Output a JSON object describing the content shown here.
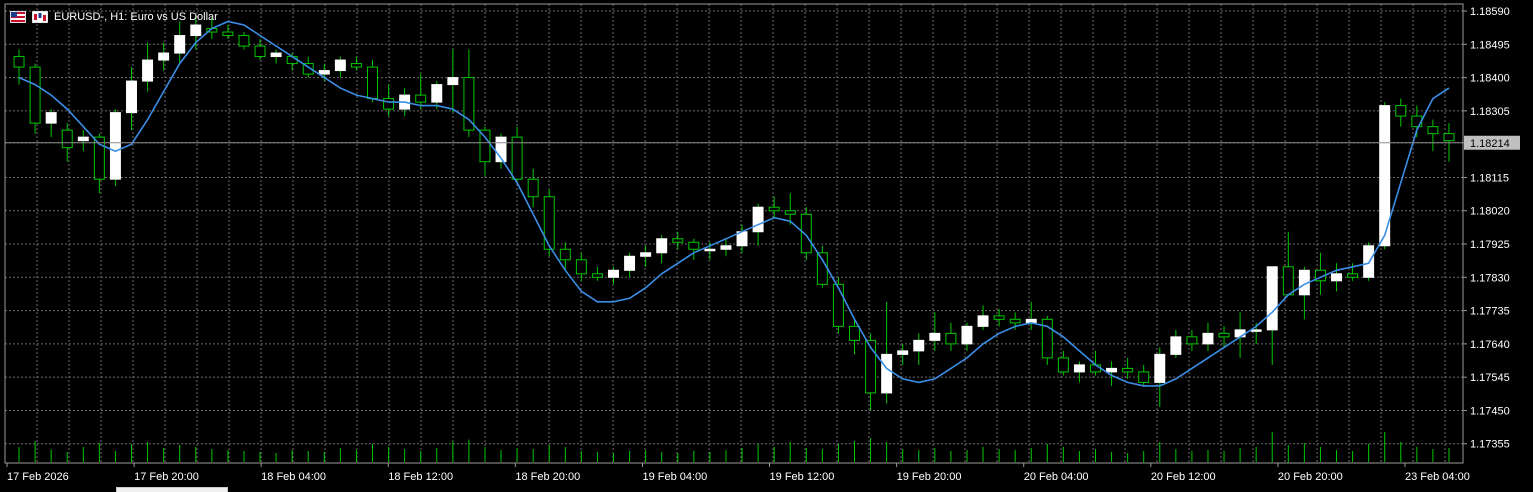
{
  "window": {
    "symbol_title": "EURUSD-, H1:  Euro vs US Dollar",
    "current_price_label": "1.18214"
  },
  "colors": {
    "background": "#000000",
    "grid": "#6b6b6b",
    "bull_candle": "#ffffff",
    "wick": "#00c800",
    "volume": "#00c800",
    "moving_average": "#3a8ee6",
    "bid_line": "#8c8c8c",
    "current_price_bg": "#c0c0c0"
  },
  "icons": [
    "flag-icon",
    "chart-type-icon"
  ],
  "chart_data": {
    "type": "candlestick",
    "timeframe": "H1",
    "price_axis": {
      "ticks": [
        "1.18590",
        "1.18495",
        "1.18400",
        "1.18305",
        "1.18214",
        "1.18115",
        "1.18020",
        "1.17925",
        "1.17830",
        "1.17735",
        "1.17640",
        "1.17545",
        "1.17450",
        "1.17355"
      ],
      "ylim": [
        1.173,
        1.1861
      ],
      "grid": true
    },
    "time_axis": {
      "labels": [
        "17 Feb 2026",
        "17 Feb 20:00",
        "18 Feb 04:00",
        "18 Feb 12:00",
        "18 Feb 20:00",
        "19 Feb 04:00",
        "19 Feb 12:00",
        "19 Feb 20:00",
        "20 Feb 04:00",
        "20 Feb 12:00",
        "20 Feb 20:00",
        "23 Feb 04:00"
      ]
    },
    "current_price": 1.18214,
    "candles": [
      [
        1.1846,
        1.1848,
        1.1838,
        1.1843
      ],
      [
        1.1843,
        1.1844,
        1.1824,
        1.1827
      ],
      [
        1.1827,
        1.1831,
        1.1823,
        1.183
      ],
      [
        1.1825,
        1.1827,
        1.1816,
        1.182
      ],
      [
        1.1822,
        1.1825,
        1.1819,
        1.1823
      ],
      [
        1.1823,
        1.1824,
        1.1807,
        1.1811
      ],
      [
        1.1811,
        1.1831,
        1.1809,
        1.183
      ],
      [
        1.183,
        1.1843,
        1.1825,
        1.1839
      ],
      [
        1.1839,
        1.185,
        1.1836,
        1.1845
      ],
      [
        1.1845,
        1.185,
        1.1842,
        1.1847
      ],
      [
        1.1847,
        1.1856,
        1.1844,
        1.1852
      ],
      [
        1.1852,
        1.1858,
        1.1848,
        1.1855
      ],
      [
        1.1854,
        1.1857,
        1.1851,
        1.1853
      ],
      [
        1.1853,
        1.1855,
        1.1851,
        1.1852
      ],
      [
        1.1852,
        1.1853,
        1.1848,
        1.1849
      ],
      [
        1.1849,
        1.1851,
        1.1845,
        1.1846
      ],
      [
        1.1846,
        1.1848,
        1.1844,
        1.1847
      ],
      [
        1.1846,
        1.1847,
        1.1842,
        1.1844
      ],
      [
        1.1844,
        1.1846,
        1.184,
        1.1841
      ],
      [
        1.1841,
        1.1844,
        1.1839,
        1.1842
      ],
      [
        1.1842,
        1.1846,
        1.184,
        1.1845
      ],
      [
        1.1844,
        1.1846,
        1.1842,
        1.1843
      ],
      [
        1.1843,
        1.1845,
        1.1833,
        1.1834
      ],
      [
        1.1834,
        1.1838,
        1.1829,
        1.1831
      ],
      [
        1.1831,
        1.1837,
        1.1829,
        1.1835
      ],
      [
        1.1835,
        1.1841,
        1.1831,
        1.1833
      ],
      [
        1.1833,
        1.1839,
        1.1831,
        1.1838
      ],
      [
        1.1838,
        1.1848,
        1.183,
        1.184
      ],
      [
        1.184,
        1.1848,
        1.1823,
        1.1825
      ],
      [
        1.1825,
        1.1826,
        1.1812,
        1.1816
      ],
      [
        1.1816,
        1.1824,
        1.1814,
        1.1823
      ],
      [
        1.1823,
        1.1826,
        1.181,
        1.1811
      ],
      [
        1.1811,
        1.1814,
        1.1803,
        1.1806
      ],
      [
        1.1806,
        1.1808,
        1.1789,
        1.1791
      ],
      [
        1.1791,
        1.1793,
        1.1785,
        1.1788
      ],
      [
        1.1788,
        1.179,
        1.1782,
        1.1784
      ],
      [
        1.1784,
        1.1786,
        1.1782,
        1.1783
      ],
      [
        1.1783,
        1.1786,
        1.1781,
        1.1785
      ],
      [
        1.1785,
        1.179,
        1.1783,
        1.1789
      ],
      [
        1.1789,
        1.1792,
        1.1786,
        1.179
      ],
      [
        1.179,
        1.1795,
        1.1787,
        1.1794
      ],
      [
        1.1794,
        1.1796,
        1.1791,
        1.1793
      ],
      [
        1.1793,
        1.1794,
        1.1788,
        1.1791
      ],
      [
        1.1791,
        1.1793,
        1.1788,
        1.1791
      ],
      [
        1.1791,
        1.1794,
        1.1789,
        1.1792
      ],
      [
        1.1792,
        1.1798,
        1.179,
        1.1796
      ],
      [
        1.1796,
        1.1804,
        1.1792,
        1.1803
      ],
      [
        1.1803,
        1.1806,
        1.18,
        1.1802
      ],
      [
        1.1802,
        1.1807,
        1.1798,
        1.1801
      ],
      [
        1.1801,
        1.1803,
        1.1788,
        1.179
      ],
      [
        1.179,
        1.1792,
        1.178,
        1.1781
      ],
      [
        1.1781,
        1.1783,
        1.1767,
        1.1769
      ],
      [
        1.1769,
        1.1771,
        1.1761,
        1.1765
      ],
      [
        1.1765,
        1.1767,
        1.1745,
        1.175
      ],
      [
        1.175,
        1.1776,
        1.1747,
        1.1761
      ],
      [
        1.1761,
        1.1764,
        1.1758,
        1.1762
      ],
      [
        1.1762,
        1.1767,
        1.1758,
        1.1765
      ],
      [
        1.1765,
        1.1773,
        1.1762,
        1.1767
      ],
      [
        1.1767,
        1.177,
        1.1762,
        1.1764
      ],
      [
        1.1764,
        1.177,
        1.1762,
        1.1769
      ],
      [
        1.1769,
        1.1775,
        1.1768,
        1.1772
      ],
      [
        1.1772,
        1.1774,
        1.1769,
        1.1771
      ],
      [
        1.1771,
        1.1773,
        1.1768,
        1.177
      ],
      [
        1.177,
        1.1776,
        1.1768,
        1.1771
      ],
      [
        1.1771,
        1.1772,
        1.1758,
        1.176
      ],
      [
        1.176,
        1.1762,
        1.1755,
        1.1756
      ],
      [
        1.1756,
        1.1759,
        1.1753,
        1.1758
      ],
      [
        1.1758,
        1.1762,
        1.1755,
        1.1756
      ],
      [
        1.1756,
        1.1759,
        1.1752,
        1.1757
      ],
      [
        1.1757,
        1.176,
        1.1754,
        1.1756
      ],
      [
        1.1756,
        1.1758,
        1.1752,
        1.1753
      ],
      [
        1.1753,
        1.1763,
        1.1746,
        1.1761
      ],
      [
        1.1761,
        1.1768,
        1.176,
        1.1766
      ],
      [
        1.1766,
        1.1768,
        1.1762,
        1.1764
      ],
      [
        1.1764,
        1.177,
        1.1762,
        1.1767
      ],
      [
        1.1767,
        1.1769,
        1.1763,
        1.1766
      ],
      [
        1.1766,
        1.1773,
        1.176,
        1.1768
      ],
      [
        1.1768,
        1.177,
        1.1764,
        1.1768
      ],
      [
        1.1768,
        1.1785,
        1.1758,
        1.1786
      ],
      [
        1.1786,
        1.1796,
        1.1778,
        1.1778
      ],
      [
        1.1778,
        1.1786,
        1.1771,
        1.1785
      ],
      [
        1.1785,
        1.179,
        1.1778,
        1.1782
      ],
      [
        1.1782,
        1.1787,
        1.1779,
        1.1784
      ],
      [
        1.1784,
        1.1787,
        1.1782,
        1.1783
      ],
      [
        1.1783,
        1.1793,
        1.1782,
        1.1792
      ],
      [
        1.1792,
        1.1833,
        1.1791,
        1.1832
      ],
      [
        1.1832,
        1.1834,
        1.1826,
        1.1829
      ],
      [
        1.1829,
        1.1832,
        1.1823,
        1.1826
      ],
      [
        1.1826,
        1.1828,
        1.1819,
        1.1824
      ],
      [
        1.1824,
        1.1827,
        1.1816,
        1.1822
      ]
    ],
    "ma_points": [
      1.184,
      1.1838,
      1.1835,
      1.1831,
      1.1826,
      1.1821,
      1.1819,
      1.1821,
      1.1828,
      1.1836,
      1.1844,
      1.185,
      1.1854,
      1.1856,
      1.1855,
      1.1852,
      1.1849,
      1.1846,
      1.1843,
      1.184,
      1.1837,
      1.1835,
      1.1834,
      1.1833,
      1.1833,
      1.1832,
      1.1832,
      1.1831,
      1.1828,
      1.1823,
      1.1817,
      1.181,
      1.1801,
      1.1792,
      1.1785,
      1.1779,
      1.1776,
      1.1776,
      1.1777,
      1.178,
      1.1784,
      1.1787,
      1.179,
      1.1792,
      1.1794,
      1.1796,
      1.1798,
      1.18,
      1.1799,
      1.1795,
      1.1788,
      1.178,
      1.1771,
      1.1763,
      1.1757,
      1.1754,
      1.1753,
      1.1754,
      1.1757,
      1.176,
      1.1764,
      1.1767,
      1.1769,
      1.177,
      1.1769,
      1.1766,
      1.1762,
      1.1758,
      1.1755,
      1.1753,
      1.1752,
      1.1752,
      1.1754,
      1.1757,
      1.176,
      1.1763,
      1.1766,
      1.1769,
      1.1773,
      1.1778,
      1.1781,
      1.1783,
      1.1785,
      1.1786,
      1.1787,
      1.1795,
      1.181,
      1.1825,
      1.1834,
      1.1837
    ],
    "volumes": [
      30,
      42,
      25,
      20,
      30,
      38,
      22,
      35,
      40,
      28,
      34,
      30,
      26,
      24,
      22,
      20,
      18,
      24,
      22,
      20,
      28,
      24,
      36,
      30,
      26,
      22,
      28,
      40,
      45,
      30,
      24,
      28,
      26,
      34,
      30,
      22,
      20,
      18,
      22,
      24,
      20,
      18,
      22,
      20,
      24,
      28,
      36,
      30,
      40,
      28,
      26,
      36,
      42,
      48,
      40,
      26,
      24,
      28,
      22,
      24,
      30,
      26,
      24,
      28,
      36,
      30,
      22,
      26,
      20,
      18,
      22,
      40,
      26,
      22,
      24,
      22,
      28,
      30,
      60,
      34,
      38,
      30,
      24,
      22,
      36,
      60,
      40,
      30,
      26,
      28
    ]
  }
}
